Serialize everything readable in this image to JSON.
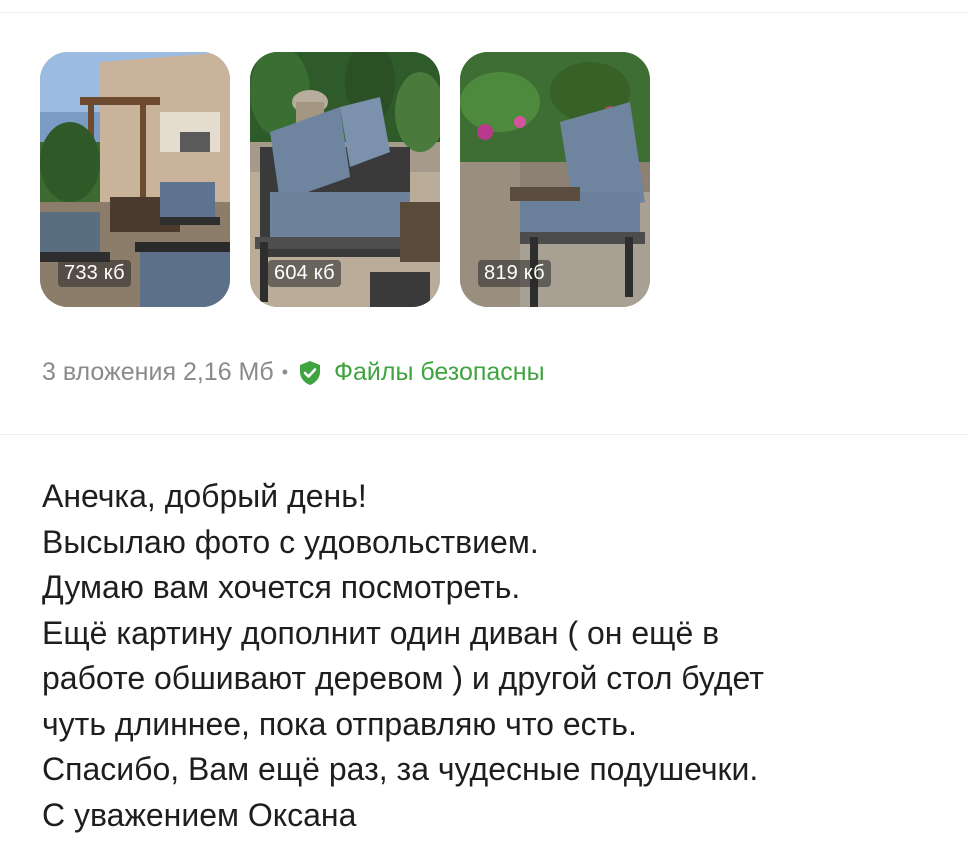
{
  "attachments": [
    {
      "size": "733 кб",
      "alt": "photo-garden-pergola"
    },
    {
      "size": "604 кб",
      "alt": "photo-sofa-with-cushions"
    },
    {
      "size": "819 кб",
      "alt": "photo-armchair-in-garden"
    }
  ],
  "meta": {
    "count_label": "3 вложения",
    "total_size": "2,16 Мб",
    "separator": "•",
    "safe_label": "Файлы безопасны"
  },
  "message": {
    "lines": [
      "Анечка, добрый день!",
      "Высылаю фото с удовольствием.",
      "Думаю вам хочется посмотреть.",
      "Ещё картину дополнит один диван ( он ещё в",
      "работе обшивают деревом ) и другой стол будет",
      "чуть длиннее, пока отправляю что есть.",
      "Спасибо, Вам ещё раз, за чудесные подушечки.",
      "С уважением Оксана"
    ]
  },
  "colors": {
    "safe_green": "#3fa33f",
    "meta_gray": "#8a8a8a",
    "text": "#1e1e1e"
  },
  "icons": {
    "safe": "shield-check-icon"
  }
}
